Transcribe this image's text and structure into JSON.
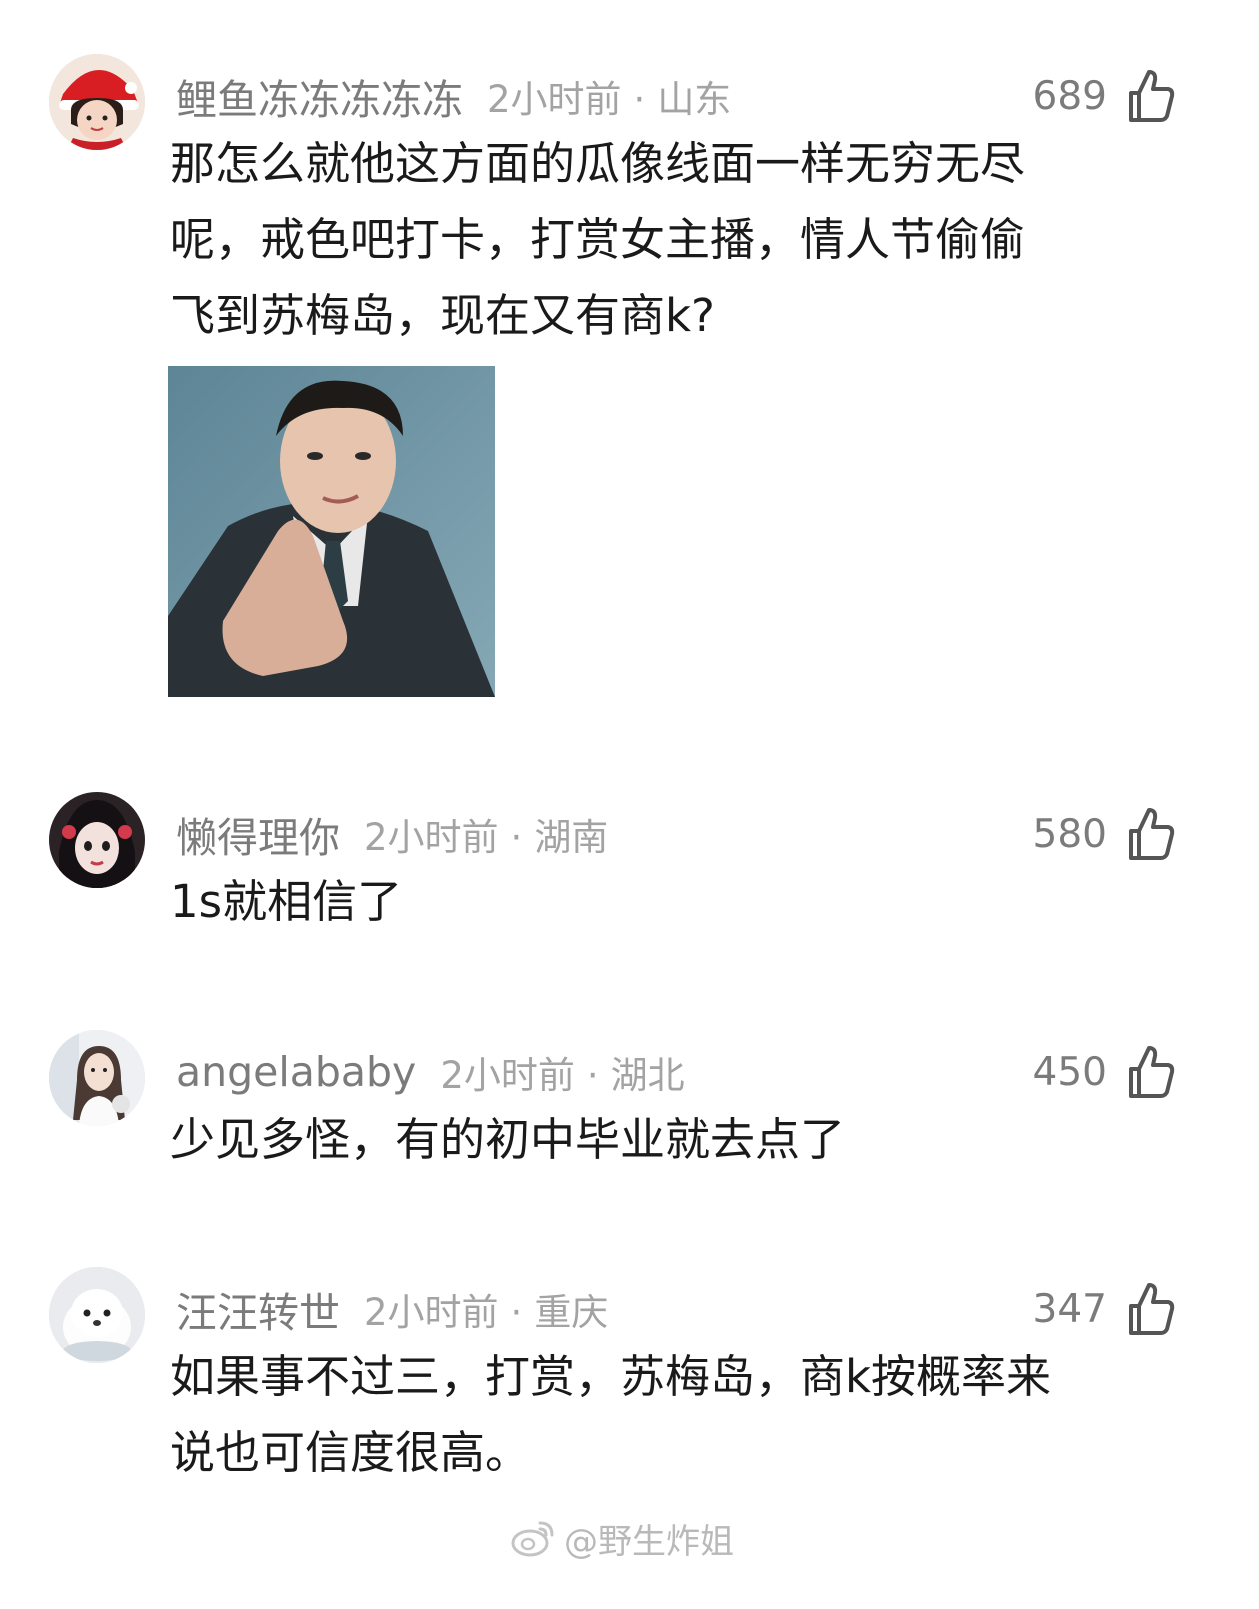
{
  "comments": [
    {
      "username": "鲤鱼冻冻冻冻冻",
      "time": "2小时前",
      "location": "山东",
      "likes": "689",
      "text_lines": [
        "那怎么就他这方面的瓜像线面一样无穷无尽",
        "呢，戒色吧打卡，打赏女主播，情人节偷偷",
        "飞到苏梅岛，现在又有商k?"
      ],
      "has_image": true
    },
    {
      "username": "懒得理你",
      "time": "2小时前",
      "location": "湖南",
      "likes": "580",
      "text_lines": [
        "1s就相信了"
      ]
    },
    {
      "username": "angelababy",
      "time": "2小时前",
      "location": "湖北",
      "likes": "450",
      "text_lines": [
        "少见多怪，有的初中毕业就去点了"
      ]
    },
    {
      "username": "汪汪转世",
      "time": "2小时前",
      "location": "重庆",
      "likes": "347",
      "text_lines": [
        "如果事不过三，打赏，苏梅岛，商k按概率来",
        "说也可信度很高。"
      ]
    }
  ],
  "separator": "·",
  "watermark": "@野生炸姐",
  "icons": {
    "like": "thumbs-up-icon",
    "watermark_logo": "weibo-logo-icon"
  }
}
